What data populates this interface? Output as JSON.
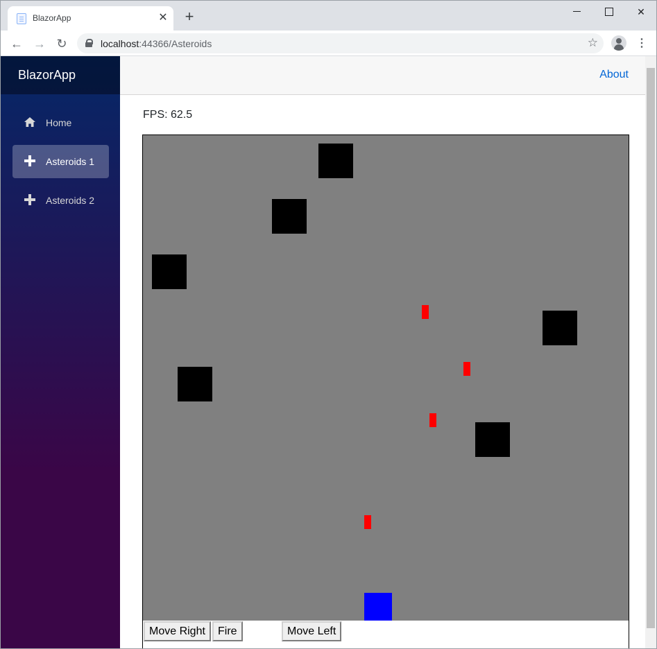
{
  "browser": {
    "tab_title": "BlazorApp",
    "tab_close": "✕",
    "new_tab": "+",
    "url_host": "localhost",
    "url_path": ":44366/Asteroids",
    "star": "☆",
    "kebab": "⋮",
    "back": "←",
    "forward": "→",
    "reload": "↻",
    "close_window": "✕"
  },
  "sidebar": {
    "brand": "BlazorApp",
    "items": [
      {
        "label": "Home",
        "icon": "home-icon",
        "active": false
      },
      {
        "label": "Asteroids 1",
        "icon": "plus-icon",
        "active": true
      },
      {
        "label": "Asteroids 2",
        "icon": "plus-icon",
        "active": false
      }
    ]
  },
  "topbar": {
    "about": "About"
  },
  "game": {
    "fps_label": "FPS: 62.5",
    "colors": {
      "background": "#808080",
      "asteroid": "#000000",
      "bullet": "#ff0000",
      "ship": "#0000ff"
    },
    "controls": [
      "Move Right",
      "Fire",
      "Move Left"
    ]
  }
}
